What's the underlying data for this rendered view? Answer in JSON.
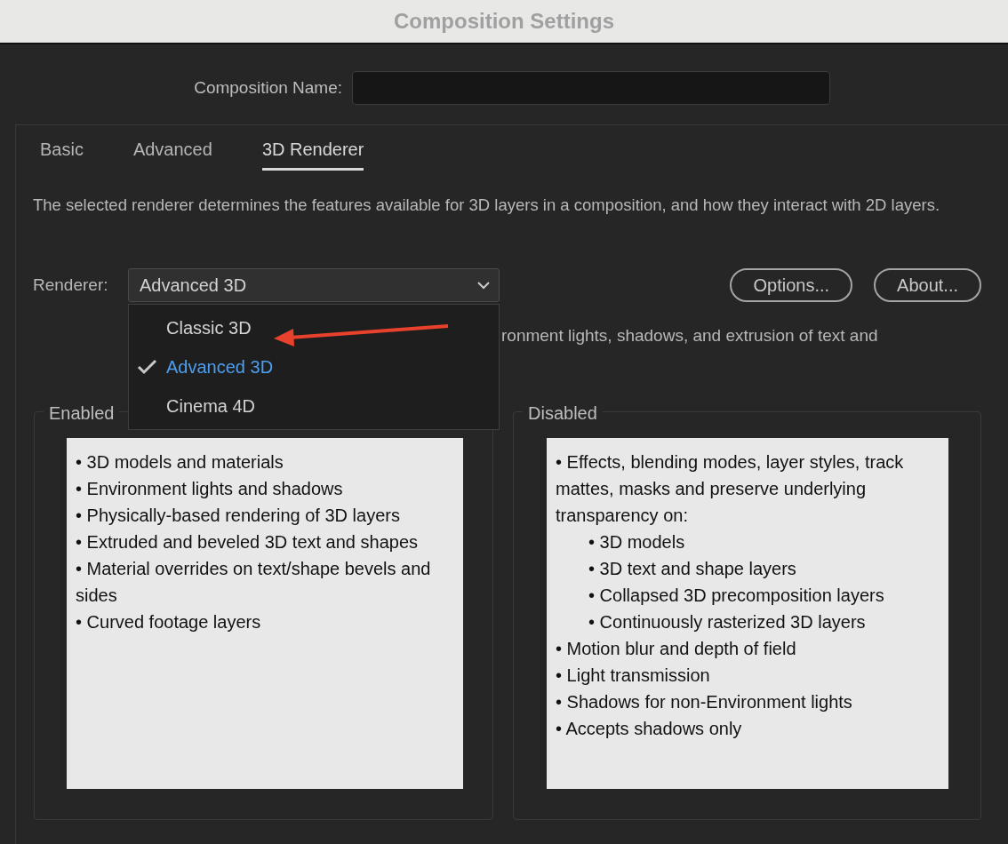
{
  "window": {
    "title": "Composition Settings"
  },
  "composition_name": {
    "label": "Composition Name:"
  },
  "tabs": [
    {
      "label": "Basic",
      "selected": false
    },
    {
      "label": "Advanced",
      "selected": false
    },
    {
      "label": "3D Renderer",
      "selected": true
    }
  ],
  "description": "The selected renderer determines the features available for 3D layers in a composition, and how they interact with 2D layers.",
  "renderer": {
    "label": "Renderer:",
    "value": "Advanced 3D",
    "expanded": true,
    "options": [
      {
        "label": "Classic 3D",
        "selected": false
      },
      {
        "label": "Advanced 3D",
        "selected": true
      },
      {
        "label": "Cinema 4D",
        "selected": false
      }
    ]
  },
  "buttons": [
    "Options...",
    "About..."
  ],
  "renderer_note": "ronment lights, shadows, and extrusion of text and",
  "enabled": {
    "title": "Enabled",
    "items": [
      {
        "text": "• 3D models and materials"
      },
      {
        "text": "• Environment lights and shadows"
      },
      {
        "text": "• Physically-based rendering of 3D layers"
      },
      {
        "text": "• Extruded and beveled 3D text and shapes"
      },
      {
        "text": "• Material overrides on text/shape bevels and sides"
      },
      {
        "text": "• Curved footage layers"
      }
    ]
  },
  "disabled": {
    "title": "Disabled",
    "items": [
      {
        "text": "• Effects, blending modes, layer styles, track mattes, masks and preserve underlying transparency on:",
        "children": [
          {
            "text": "• 3D models"
          },
          {
            "text": "• 3D text and shape layers"
          },
          {
            "text": "• Collapsed 3D precomposition layers"
          },
          {
            "text": "• Continuously rasterized 3D layers"
          }
        ]
      },
      {
        "text": "• Motion blur and depth of field"
      },
      {
        "text": "• Light transmission"
      },
      {
        "text": "• Shadows for non-Environment lights"
      },
      {
        "text": "• Accepts shadows only"
      }
    ]
  }
}
